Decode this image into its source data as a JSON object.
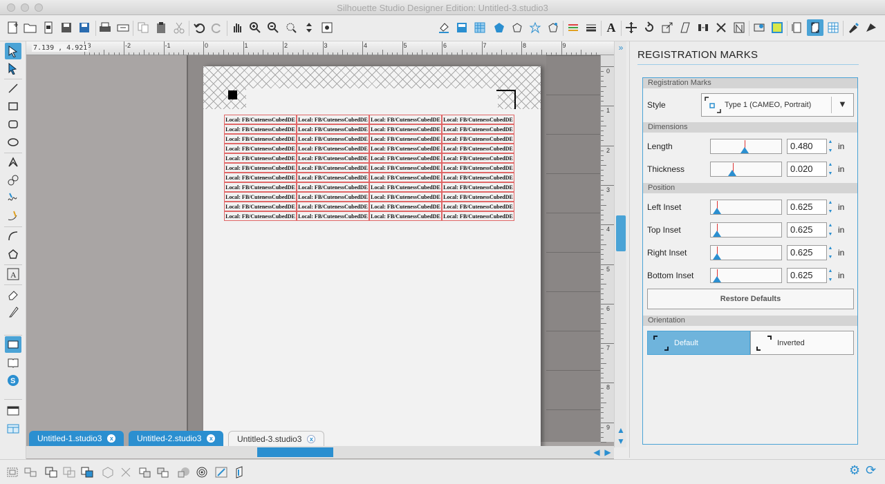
{
  "window": {
    "title": "Silhouette Studio Designer Edition: Untitled-3.studio3"
  },
  "canvas": {
    "coordinates": "7.139 , 4.921",
    "ruler_numbers_h": [
      "-3",
      "-2",
      "-1",
      "0",
      "1",
      "2",
      "3",
      "4",
      "5",
      "6",
      "7",
      "8",
      "9"
    ],
    "ruler_numbers_v": [
      "0",
      "1",
      "2",
      "3",
      "4",
      "5",
      "6",
      "7",
      "8",
      "9"
    ],
    "label_text": "Local: FB/CutenessCubedDE",
    "label_rows": 11,
    "label_cols": 4
  },
  "tabs": [
    {
      "label": "Untitled-1.studio3",
      "close": "x"
    },
    {
      "label": "Untitled-2.studio3",
      "close": "x"
    },
    {
      "label": "Untitled-3.studio3",
      "close": "x"
    }
  ],
  "panel": {
    "title": "REGISTRATION MARKS",
    "section_registration": "Registration Marks",
    "style_label": "Style",
    "style_value": "Type 1 (CAMEO, Portrait)",
    "section_dimensions": "Dimensions",
    "length_label": "Length",
    "length_value": "0.480",
    "thickness_label": "Thickness",
    "thickness_value": "0.020",
    "section_position": "Position",
    "left_inset_label": "Left Inset",
    "left_inset_value": "0.625",
    "top_inset_label": "Top Inset",
    "top_inset_value": "0.625",
    "right_inset_label": "Right Inset",
    "right_inset_value": "0.625",
    "bottom_inset_label": "Bottom Inset",
    "bottom_inset_value": "0.625",
    "unit": "in",
    "restore_label": "Restore Defaults",
    "section_orientation": "Orientation",
    "orient_default": "Default",
    "orient_inverted": "Inverted"
  },
  "colors": {
    "accent": "#2b8fd0",
    "accent_light": "#6fb4dc",
    "label_border": "#e06666"
  }
}
